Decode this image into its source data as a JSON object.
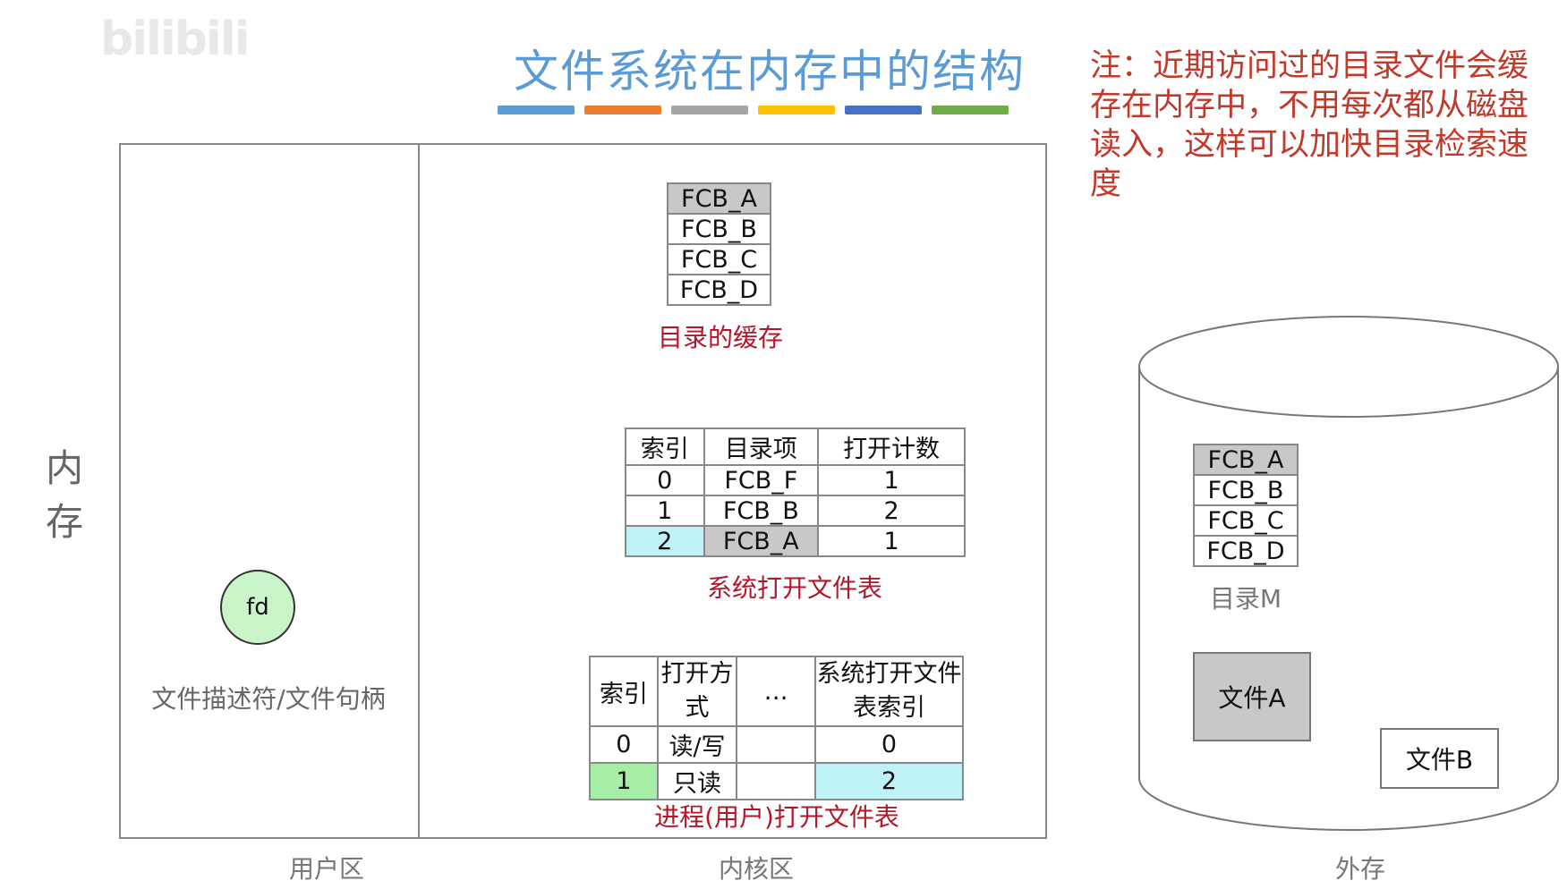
{
  "watermark": "bilibili",
  "title": "文件系统在内存中的结构",
  "accent_colors": [
    "#5b9bd5",
    "#ed7d31",
    "#a5a5a5",
    "#ffc000",
    "#4472c4",
    "#70ad47"
  ],
  "note": "注：近期访问过的目录文件会缓存在内存中，不用每次都从磁盘读入，这样可以加快目录检索速度",
  "memory_label": [
    "内",
    "存"
  ],
  "zones": {
    "user": "用户区",
    "kernel": "内核区",
    "external": "外存"
  },
  "fd": {
    "label": "fd",
    "description": "文件描述符/文件句柄"
  },
  "dir_cache": {
    "items": [
      "FCB_A",
      "FCB_B",
      "FCB_C",
      "FCB_D"
    ],
    "caption": "目录的缓存"
  },
  "system_open_table": {
    "headers": [
      "索引",
      "目录项",
      "打开计数"
    ],
    "rows": [
      [
        "0",
        "FCB_F",
        "1"
      ],
      [
        "1",
        "FCB_B",
        "2"
      ],
      [
        "2",
        "FCB_A",
        "1"
      ]
    ],
    "caption": "系统打开文件表"
  },
  "process_open_table": {
    "headers": [
      "索引",
      "打开方式",
      "…",
      "系统打开文件表索引"
    ],
    "rows": [
      [
        "0",
        "读/写",
        "",
        "0"
      ],
      [
        "1",
        "只读",
        "",
        "2"
      ]
    ],
    "caption": "进程(用户)打开文件表"
  },
  "disk": {
    "directory_items": [
      "FCB_A",
      "FCB_B",
      "FCB_C",
      "FCB_D"
    ],
    "directory_label": "目录M",
    "file_a": "文件A",
    "file_b": "文件B"
  }
}
